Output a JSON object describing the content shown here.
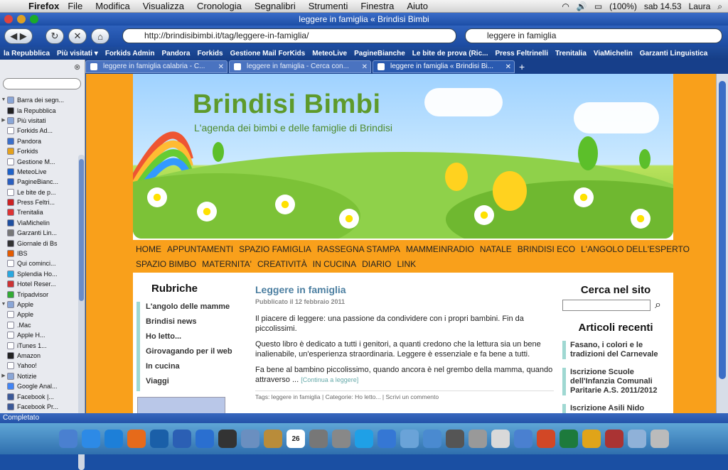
{
  "menubar": {
    "app": "Firefox",
    "items": [
      "File",
      "Modifica",
      "Visualizza",
      "Cronologia",
      "Segnalibri",
      "Strumenti",
      "Finestra",
      "Aiuto"
    ],
    "battery": "(100%)",
    "clock": "sab 14.53",
    "user": "Laura"
  },
  "window": {
    "title": "leggere in famiglia « Brindisi Bimbi"
  },
  "navbar": {
    "url": "http://brindisibimbi.it/tag/leggere-in-famiglia/",
    "search": "leggere in famiglia"
  },
  "bookmarks": [
    "la Repubblica",
    "Più visitati ▾",
    "Forkids Admin",
    "Pandora",
    "Forkids",
    "Gestione Mail ForKids",
    "MeteoLive",
    "PagineBianche",
    "Le bite de prova (Ric...",
    "Press Feltrinelli",
    "Trenitalia",
    "ViaMichelin",
    "Garzanti Linguistica"
  ],
  "tabs": [
    {
      "label": "leggere in famiglia calabria - C..."
    },
    {
      "label": "leggere in famiglia - Cerca con..."
    },
    {
      "label": "leggere in famiglia « Brindisi Bi..."
    }
  ],
  "sidebar": {
    "items": [
      {
        "label": "Barra dei segn...",
        "icon": "folder-icon",
        "arrow": "▼"
      },
      {
        "label": "la Repubblica",
        "icon": "repubblica-icon",
        "arrow": ""
      },
      {
        "label": "Più visitati",
        "icon": "folder-icon",
        "arrow": "▶"
      },
      {
        "label": "Forkids Ad...",
        "icon": "page-icon",
        "arrow": ""
      },
      {
        "label": "Pandora",
        "icon": "pandora-icon",
        "arrow": ""
      },
      {
        "label": "Forkids",
        "icon": "forkids-icon",
        "arrow": ""
      },
      {
        "label": "Gestione M...",
        "icon": "page-icon",
        "arrow": ""
      },
      {
        "label": "MeteoLive",
        "icon": "meteo-icon",
        "arrow": ""
      },
      {
        "label": "PagineBianc...",
        "icon": "pagine-icon",
        "arrow": ""
      },
      {
        "label": "Le bite de p...",
        "icon": "page-icon",
        "arrow": ""
      },
      {
        "label": "Press Feltri...",
        "icon": "feltrinelli-icon",
        "arrow": ""
      },
      {
        "label": "Trenitalia",
        "icon": "trenitalia-icon",
        "arrow": ""
      },
      {
        "label": "ViaMichelin",
        "icon": "michelin-icon",
        "arrow": ""
      },
      {
        "label": "Garzanti Lin...",
        "icon": "garzanti-icon",
        "arrow": ""
      },
      {
        "label": "Giornale di Bs",
        "icon": "giornale-icon",
        "arrow": ""
      },
      {
        "label": "IBS",
        "icon": "ibs-icon",
        "arrow": ""
      },
      {
        "label": "Qui cominci...",
        "icon": "page-icon",
        "arrow": ""
      },
      {
        "label": "Splendia Ho...",
        "icon": "splendia-icon",
        "arrow": ""
      },
      {
        "label": "Hotel Reser...",
        "icon": "hotel-icon",
        "arrow": ""
      },
      {
        "label": "Tripadvisor",
        "icon": "tripadvisor-icon",
        "arrow": ""
      },
      {
        "label": "Apple",
        "icon": "folder-icon",
        "arrow": "▼"
      },
      {
        "label": "Apple",
        "icon": "page-icon",
        "arrow": ""
      },
      {
        "label": ".Mac",
        "icon": "page-icon",
        "arrow": ""
      },
      {
        "label": "Apple H...",
        "icon": "page-icon",
        "arrow": ""
      },
      {
        "label": "iTunes 1...",
        "icon": "page-icon",
        "arrow": ""
      },
      {
        "label": "Amazon",
        "icon": "amazon-icon",
        "arrow": ""
      },
      {
        "label": "Yahoo!",
        "icon": "page-icon",
        "arrow": ""
      },
      {
        "label": "Notizie",
        "icon": "folder-icon",
        "arrow": "▶"
      },
      {
        "label": "Google Anal...",
        "icon": "google-icon",
        "arrow": ""
      },
      {
        "label": "Facebook |...",
        "icon": "facebook-icon",
        "arrow": ""
      },
      {
        "label": "Facebook Pr...",
        "icon": "facebook-icon",
        "arrow": ""
      }
    ]
  },
  "site": {
    "title": "Brindisi Bimbi",
    "tagline": "L'agenda dei bimbi e delle famiglie di Brindisi"
  },
  "nav": {
    "row1": [
      "HOME",
      "APPUNTAMENTI",
      "SPAZIO FAMIGLIA",
      "RASSEGNA STAMPA",
      "MAMMEINRADIO",
      "NATALE",
      "BRINDISI ECO",
      "L'ANGOLO DELL'ESPERTO"
    ],
    "row2": [
      "SPAZIO BIMBO",
      "MATERNITA'",
      "CREATIVITÀ",
      "IN CUCINA",
      "DIARIO",
      "LINK"
    ]
  },
  "rubriche": {
    "title": "Rubriche",
    "items": [
      "L'angolo delle mamme",
      "Brindisi news",
      "Ho letto...",
      "Girovagando per il web",
      "In cucina",
      "Viaggi"
    ]
  },
  "post": {
    "title": "Leggere in famiglia",
    "meta": "Pubblicato il 12 febbraio 2011",
    "p1": "Il piacere di leggere: una passione da condividere con i propri bambini. Fin da piccolissimi.",
    "p2": "Questo libro è dedicato a tutti i genitori, a quanti credono che la lettura sia un bene inalienabile, un'esperienza straordinaria. Leggere è essenziale e fa bene a tutti.",
    "p3": "Fa bene al bambino piccolissimo, quando ancora è nel grembo della mamma, quando attraverso ...",
    "more": "[Continua a leggere]",
    "tags": "Tags: leggere in famiglia | Categorie: Ho letto... | Scrivi un commento"
  },
  "right": {
    "search_title": "Cerca nel sito",
    "recent_title": "Articoli recenti",
    "articles": [
      "Fasano, i colori e le tradizioni del Carnevale",
      "Iscrizione Scuole dell'Infanzia Comunali Paritarie A.S. 2011/2012",
      "Iscrizione Asili Nido"
    ]
  },
  "status": "Completato",
  "dock": {
    "calendar": "26",
    "icons": [
      "finder-icon",
      "appstore-icon",
      "safari-icon",
      "firefox-icon",
      "photoshop-icon",
      "word-icon",
      "quicktime-icon",
      "dashboard-icon",
      "preview-icon",
      "address-book-icon",
      "calendar-icon",
      "system-prefs-icon",
      "calculator-icon",
      "skype-icon",
      "itunes-icon",
      "iphoto-icon",
      "mail-icon",
      "imovie-icon",
      "chess-icon",
      "wind-icon",
      "finder-icon",
      "powerpoint-icon",
      "excel-icon",
      "outlook-icon",
      "photo-booth-icon",
      "folder-icon",
      "trash-icon"
    ]
  }
}
